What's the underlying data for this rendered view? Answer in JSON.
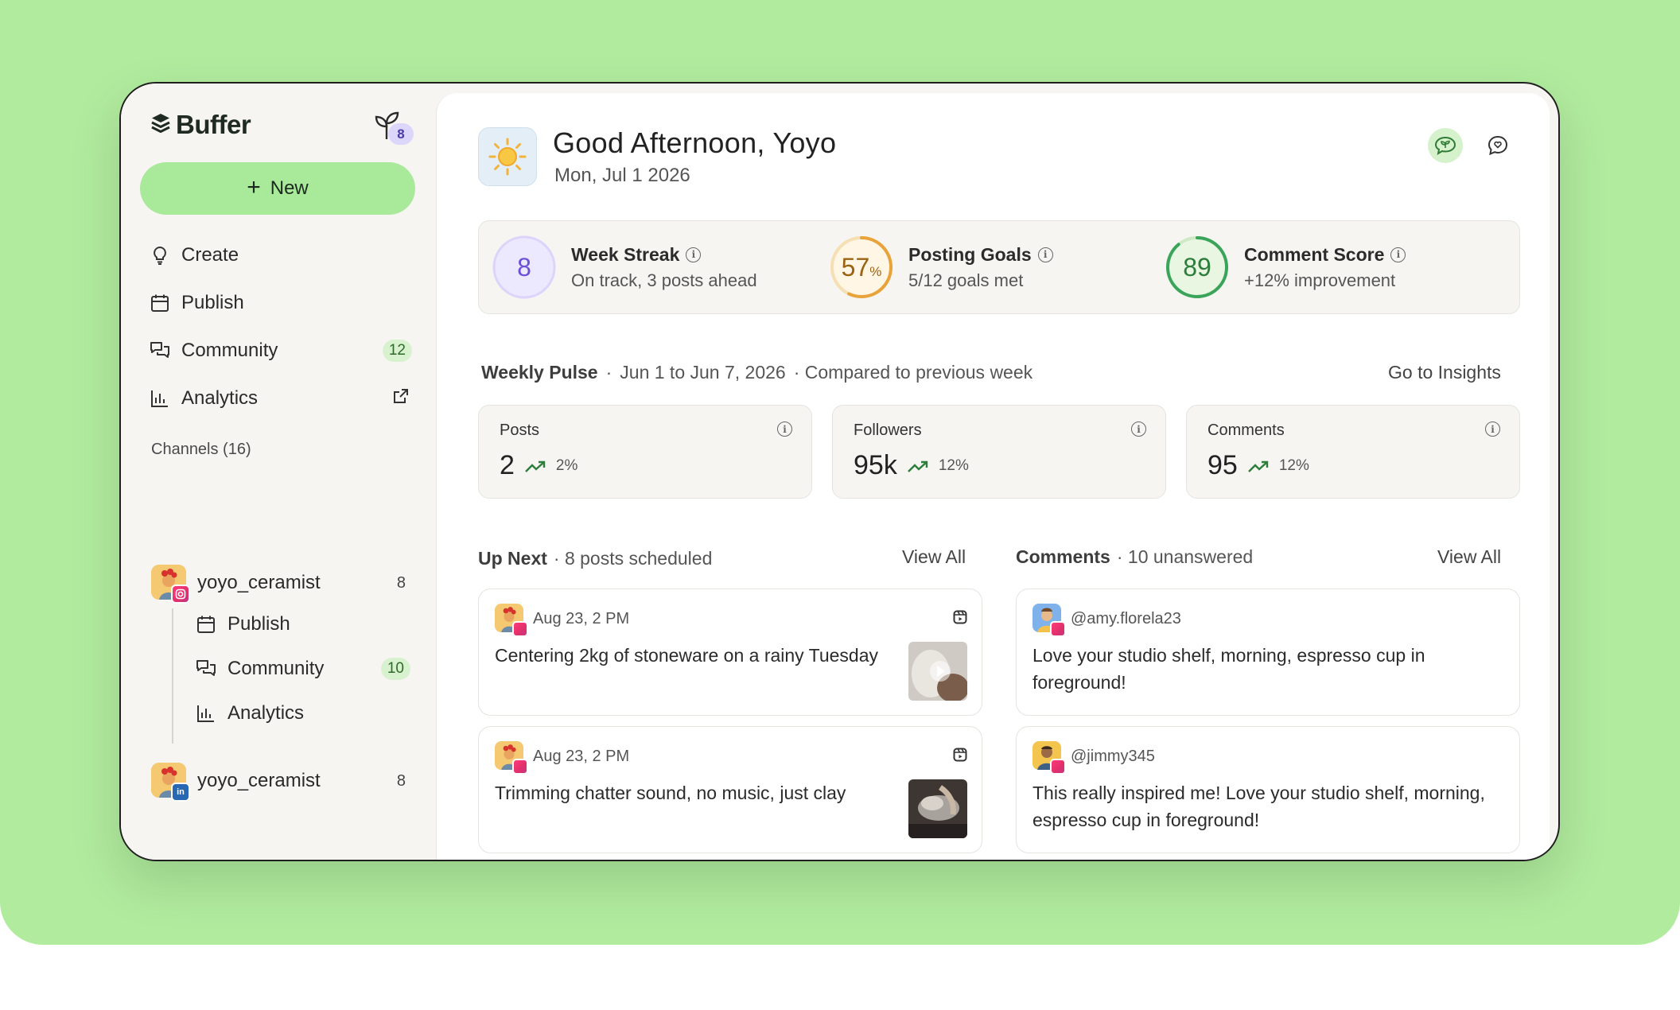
{
  "brand": {
    "name": "Buffer",
    "sprout_count": "8"
  },
  "sidebar": {
    "new_label": "New",
    "nav": [
      {
        "label": "Create",
        "icon": "lightbulb-icon"
      },
      {
        "label": "Publish",
        "icon": "calendar-icon"
      },
      {
        "label": "Community",
        "icon": "chat-icon",
        "badge": "12"
      },
      {
        "label": "Analytics",
        "icon": "bar-chart-icon"
      }
    ],
    "channels_title": "Channels (16)",
    "channels": [
      {
        "name": "yoyo_ceramist",
        "count": "8",
        "platform": "instagram",
        "sub": [
          {
            "label": "Publish",
            "icon": "calendar-icon"
          },
          {
            "label": "Community",
            "icon": "chat-icon",
            "badge": "10"
          },
          {
            "label": "Analytics",
            "icon": "bar-chart-icon"
          }
        ]
      },
      {
        "name": "yoyo_ceramist",
        "count": "8",
        "platform": "linkedin",
        "platform_mark": "in"
      }
    ]
  },
  "header": {
    "greeting": "Good Afternoon, Yoyo",
    "date": "Mon, Jul 1 2026"
  },
  "stats": [
    {
      "value": "8",
      "label": "Week Streak",
      "sub": "On track, 3 posts ahead"
    },
    {
      "value": "57",
      "unit": "%",
      "progress": 0.57,
      "label": "Posting Goals",
      "sub": "5/12 goals met"
    },
    {
      "value": "89",
      "progress": 0.89,
      "label": "Comment Score",
      "sub": "+12% improvement"
    }
  ],
  "pulse": {
    "title": "Weekly Pulse",
    "sep": "·",
    "range": "Jun 1 to Jun 7, 2026",
    "compare": "· Compared to previous week",
    "link": "Go to Insights"
  },
  "metrics": [
    {
      "title": "Posts",
      "value": "2",
      "change": "2%"
    },
    {
      "title": "Followers",
      "value": "95k",
      "change": "12%"
    },
    {
      "title": "Comments",
      "value": "95",
      "change": "12%"
    }
  ],
  "up_next": {
    "title": "Up Next",
    "sub": "· 8 posts scheduled",
    "view_all": "View All",
    "posts": [
      {
        "time": "Aug 23, 2 PM",
        "text": "Centering 2kg of stoneware on a rainy Tuesday"
      },
      {
        "time": "Aug 23, 2 PM",
        "text": "Trimming chatter sound, no music, just clay"
      }
    ]
  },
  "comments": {
    "title": "Comments",
    "sub": "· 10 unanswered",
    "view_all": "View All",
    "items": [
      {
        "handle": "@amy.florela23",
        "text": "Love your studio shelf, morning, espresso cup in foreground!"
      },
      {
        "handle": "@jimmy345",
        "text": "This really inspired me! Love your studio shelf, morning, espresso cup in foreground!"
      }
    ]
  },
  "colors": {
    "background": "#b1eb9e",
    "accent_green": "#a9e99a",
    "purple": "#6b4fd8",
    "gold": "#e8a33a",
    "green": "#3aa55a"
  }
}
